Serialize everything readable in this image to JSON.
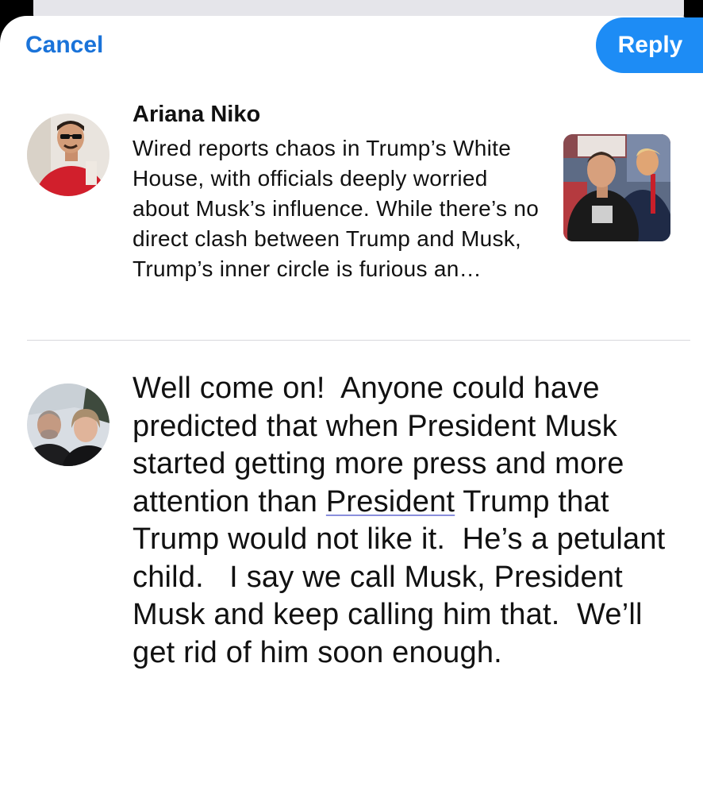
{
  "header": {
    "cancel_label": "Cancel",
    "reply_label": "Reply"
  },
  "original_post": {
    "author": "Ariana Niko",
    "text": "Wired reports chaos in Trump’s White House, with officials deeply worried about Musk’s influence. While there’s no direct clash between Trump and Musk, Trump’s inner circle is furious an…",
    "thumbnail_caption": "SAVE\nCA!"
  },
  "reply": {
    "text_before": "Well come on!  Anyone could have predicted that when President Musk started getting more press and more attention than ",
    "misspelled_word": "President",
    "text_after": " Trump that Trump would not like it.  He’s a petulant child.   I say we call Musk, President Musk and keep calling him that.  We’ll get rid of him soon enough."
  },
  "colors": {
    "accent": "#1d8cf5",
    "link": "#1a73d9",
    "spellcheck_underline": "#8a8fdc"
  },
  "icons": {
    "author_avatar": "person-photo-avatar",
    "reply_avatar": "couple-photo-avatar",
    "thumbnail": "news-photo-thumbnail"
  }
}
